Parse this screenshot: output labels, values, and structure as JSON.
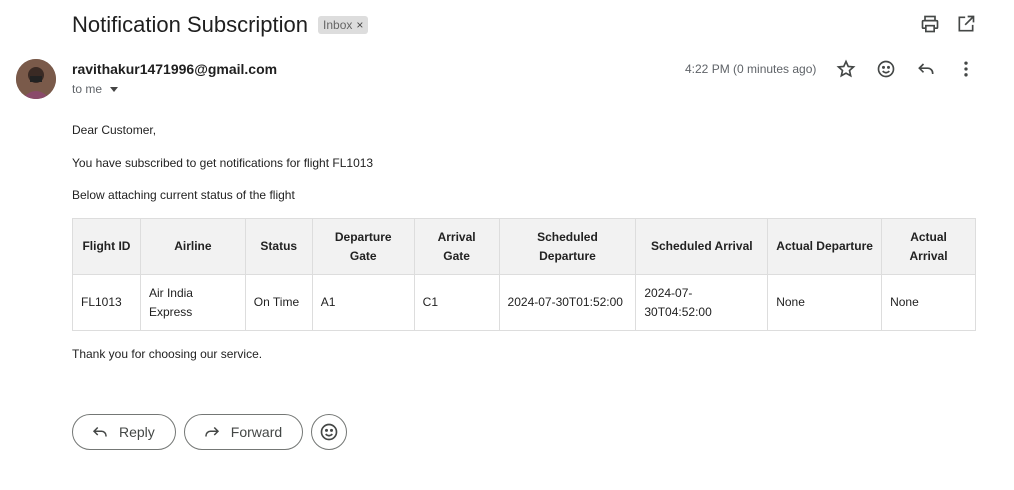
{
  "email": {
    "subject": "Notification Subscription",
    "label": "Inbox",
    "label_remove": "×",
    "sender": "ravithakur1471996@gmail.com",
    "recipient": "to me",
    "time": "4:22 PM (0 minutes ago)"
  },
  "body": {
    "greeting": "Dear Customer,",
    "line1": "You have subscribed to get notifications for flight FL1013",
    "line2": "Below attaching current status of the flight",
    "closing": "Thank you for choosing our service."
  },
  "table": {
    "headers": [
      "Flight ID",
      "Airline",
      "Status",
      "Departure Gate",
      "Arrival Gate",
      "Scheduled Departure",
      "Scheduled Arrival",
      "Actual Departure",
      "Actual Arrival"
    ],
    "rows": [
      [
        "FL1013",
        "Air India Express",
        "On Time",
        "A1",
        "C1",
        "2024-07-30T01:52:00",
        "2024-07-30T04:52:00",
        "None",
        "None"
      ]
    ]
  },
  "actions": {
    "reply": "Reply",
    "forward": "Forward"
  },
  "icons": {
    "print": "print-icon",
    "open_new": "open-in-new-window-icon",
    "star": "star-icon",
    "emoji": "emoji-icon",
    "reply": "reply-icon",
    "more": "more-vert-icon",
    "forward": "forward-icon"
  }
}
